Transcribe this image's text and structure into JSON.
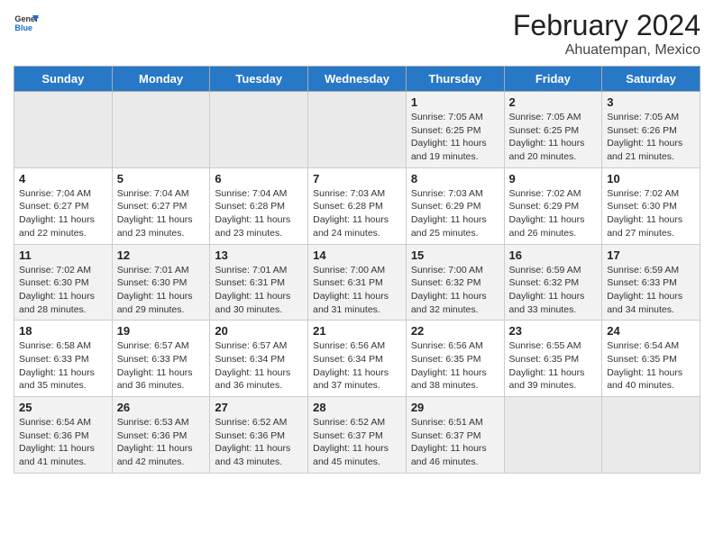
{
  "header": {
    "logo_general": "General",
    "logo_blue": "Blue",
    "title": "February 2024",
    "subtitle": "Ahuatempan, Mexico"
  },
  "days_of_week": [
    "Sunday",
    "Monday",
    "Tuesday",
    "Wednesday",
    "Thursday",
    "Friday",
    "Saturday"
  ],
  "weeks": [
    [
      {
        "day": "",
        "info": ""
      },
      {
        "day": "",
        "info": ""
      },
      {
        "day": "",
        "info": ""
      },
      {
        "day": "",
        "info": ""
      },
      {
        "day": "1",
        "info": "Sunrise: 7:05 AM\nSunset: 6:25 PM\nDaylight: 11 hours and 19 minutes."
      },
      {
        "day": "2",
        "info": "Sunrise: 7:05 AM\nSunset: 6:25 PM\nDaylight: 11 hours and 20 minutes."
      },
      {
        "day": "3",
        "info": "Sunrise: 7:05 AM\nSunset: 6:26 PM\nDaylight: 11 hours and 21 minutes."
      }
    ],
    [
      {
        "day": "4",
        "info": "Sunrise: 7:04 AM\nSunset: 6:27 PM\nDaylight: 11 hours and 22 minutes."
      },
      {
        "day": "5",
        "info": "Sunrise: 7:04 AM\nSunset: 6:27 PM\nDaylight: 11 hours and 23 minutes."
      },
      {
        "day": "6",
        "info": "Sunrise: 7:04 AM\nSunset: 6:28 PM\nDaylight: 11 hours and 23 minutes."
      },
      {
        "day": "7",
        "info": "Sunrise: 7:03 AM\nSunset: 6:28 PM\nDaylight: 11 hours and 24 minutes."
      },
      {
        "day": "8",
        "info": "Sunrise: 7:03 AM\nSunset: 6:29 PM\nDaylight: 11 hours and 25 minutes."
      },
      {
        "day": "9",
        "info": "Sunrise: 7:02 AM\nSunset: 6:29 PM\nDaylight: 11 hours and 26 minutes."
      },
      {
        "day": "10",
        "info": "Sunrise: 7:02 AM\nSunset: 6:30 PM\nDaylight: 11 hours and 27 minutes."
      }
    ],
    [
      {
        "day": "11",
        "info": "Sunrise: 7:02 AM\nSunset: 6:30 PM\nDaylight: 11 hours and 28 minutes."
      },
      {
        "day": "12",
        "info": "Sunrise: 7:01 AM\nSunset: 6:30 PM\nDaylight: 11 hours and 29 minutes."
      },
      {
        "day": "13",
        "info": "Sunrise: 7:01 AM\nSunset: 6:31 PM\nDaylight: 11 hours and 30 minutes."
      },
      {
        "day": "14",
        "info": "Sunrise: 7:00 AM\nSunset: 6:31 PM\nDaylight: 11 hours and 31 minutes."
      },
      {
        "day": "15",
        "info": "Sunrise: 7:00 AM\nSunset: 6:32 PM\nDaylight: 11 hours and 32 minutes."
      },
      {
        "day": "16",
        "info": "Sunrise: 6:59 AM\nSunset: 6:32 PM\nDaylight: 11 hours and 33 minutes."
      },
      {
        "day": "17",
        "info": "Sunrise: 6:59 AM\nSunset: 6:33 PM\nDaylight: 11 hours and 34 minutes."
      }
    ],
    [
      {
        "day": "18",
        "info": "Sunrise: 6:58 AM\nSunset: 6:33 PM\nDaylight: 11 hours and 35 minutes."
      },
      {
        "day": "19",
        "info": "Sunrise: 6:57 AM\nSunset: 6:33 PM\nDaylight: 11 hours and 36 minutes."
      },
      {
        "day": "20",
        "info": "Sunrise: 6:57 AM\nSunset: 6:34 PM\nDaylight: 11 hours and 36 minutes."
      },
      {
        "day": "21",
        "info": "Sunrise: 6:56 AM\nSunset: 6:34 PM\nDaylight: 11 hours and 37 minutes."
      },
      {
        "day": "22",
        "info": "Sunrise: 6:56 AM\nSunset: 6:35 PM\nDaylight: 11 hours and 38 minutes."
      },
      {
        "day": "23",
        "info": "Sunrise: 6:55 AM\nSunset: 6:35 PM\nDaylight: 11 hours and 39 minutes."
      },
      {
        "day": "24",
        "info": "Sunrise: 6:54 AM\nSunset: 6:35 PM\nDaylight: 11 hours and 40 minutes."
      }
    ],
    [
      {
        "day": "25",
        "info": "Sunrise: 6:54 AM\nSunset: 6:36 PM\nDaylight: 11 hours and 41 minutes."
      },
      {
        "day": "26",
        "info": "Sunrise: 6:53 AM\nSunset: 6:36 PM\nDaylight: 11 hours and 42 minutes."
      },
      {
        "day": "27",
        "info": "Sunrise: 6:52 AM\nSunset: 6:36 PM\nDaylight: 11 hours and 43 minutes."
      },
      {
        "day": "28",
        "info": "Sunrise: 6:52 AM\nSunset: 6:37 PM\nDaylight: 11 hours and 45 minutes."
      },
      {
        "day": "29",
        "info": "Sunrise: 6:51 AM\nSunset: 6:37 PM\nDaylight: 11 hours and 46 minutes."
      },
      {
        "day": "",
        "info": ""
      },
      {
        "day": "",
        "info": ""
      }
    ]
  ]
}
